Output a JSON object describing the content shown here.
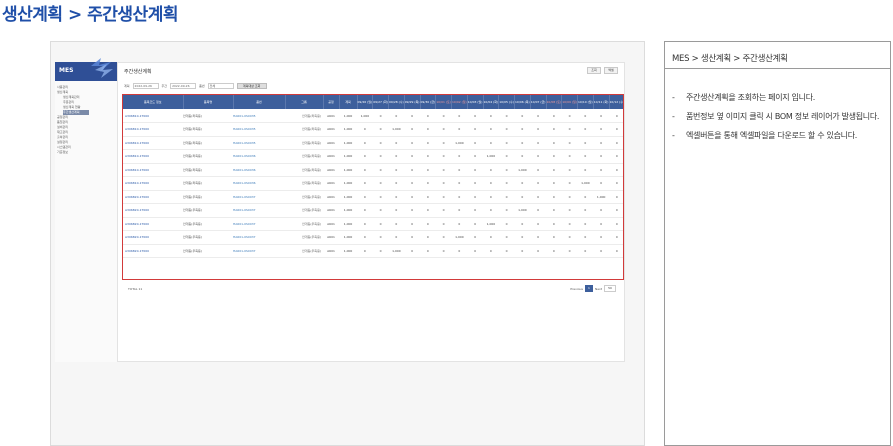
{
  "page_heading": "생산계획 > 주간생산계획",
  "screenshot": {
    "logo": "MES",
    "menu": [
      "사용관리",
      "생산계획",
      "생산계획관리",
      "주문관리",
      "생산계획 현황",
      "주간생산계획",
      "공정관리",
      "품질관리",
      "설비관리",
      "재고관리",
      "출하관리",
      "설정관리",
      "시스템관리",
      "기준정보"
    ],
    "title": "주간생산계획",
    "buttons": [
      "조회",
      "엑셀"
    ],
    "filters": {
      "label_plan": "계획",
      "plan_value": "2022-09-26",
      "label_week": "주간",
      "week_value": "2022-09-26",
      "label_item": "품번",
      "item_value": "전체",
      "search_label": "계획대상 조회"
    },
    "columns": [
      "품목코드 정보",
      "품목명",
      "품번",
      "그룹",
      "공정",
      "계획",
      "09/26 (월)",
      "09/27 (화)",
      "09/28 (수)",
      "09/29 (목)",
      "09/30 (금)",
      "10/01 (토)",
      "10/02 (일)",
      "10/03 (월)",
      "10/04 (화)",
      "10/05 (수)",
      "10/06 (목)",
      "10/07 (금)",
      "10/08 (토)",
      "10/09 (일)",
      "10/10 (월)",
      "10/11 (화)",
      "10/12 (수)"
    ],
    "rows": [
      {
        "code": "A306810-1T000",
        "name": "안개등(좌측용)",
        "part": "HA601-0S0035",
        "group": "안개등(좌측용)",
        "process": "A601",
        "plan": "1,000",
        "cells": [
          "1,000",
          "0",
          "0",
          "0",
          "0",
          "0",
          "0",
          "0",
          "0",
          "0",
          "0",
          "0",
          "0",
          "0",
          "0",
          "0",
          "0"
        ]
      },
      {
        "code": "A306810-1T000",
        "name": "안개등(좌측용)",
        "part": "HA601-0S0035",
        "group": "안개등(좌측용)",
        "process": "A601",
        "plan": "1,000",
        "cells": [
          "0",
          "0",
          "1,000",
          "0",
          "0",
          "0",
          "0",
          "0",
          "0",
          "0",
          "0",
          "0",
          "0",
          "0",
          "0",
          "0",
          "0"
        ]
      },
      {
        "code": "A306810-1T000",
        "name": "안개등(좌측용)",
        "part": "HA601-0S0035",
        "group": "안개등(좌측용)",
        "process": "A601",
        "plan": "1,000",
        "cells": [
          "0",
          "0",
          "0",
          "0",
          "0",
          "0",
          "1,000",
          "0",
          "0",
          "0",
          "0",
          "0",
          "0",
          "0",
          "0",
          "0",
          "0"
        ]
      },
      {
        "code": "A306810-1T000",
        "name": "안개등(좌측용)",
        "part": "HA601-0S0036",
        "group": "안개등(좌측용)",
        "process": "A601",
        "plan": "1,000",
        "cells": [
          "0",
          "0",
          "0",
          "0",
          "0",
          "0",
          "0",
          "0",
          "1,000",
          "0",
          "0",
          "0",
          "0",
          "0",
          "0",
          "0",
          "0"
        ]
      },
      {
        "code": "A306810-1T000",
        "name": "안개등(좌측용)",
        "part": "HA601-0S0036",
        "group": "안개등(좌측용)",
        "process": "A601",
        "plan": "1,000",
        "cells": [
          "0",
          "0",
          "0",
          "0",
          "0",
          "0",
          "0",
          "0",
          "0",
          "0",
          "1,000",
          "0",
          "0",
          "0",
          "0",
          "0",
          "0"
        ]
      },
      {
        "code": "A306810-1T000",
        "name": "안개등(좌측용)",
        "part": "HA601-0S0036",
        "group": "안개등(좌측용)",
        "process": "A601",
        "plan": "1,000",
        "cells": [
          "0",
          "0",
          "0",
          "0",
          "0",
          "0",
          "0",
          "0",
          "0",
          "0",
          "0",
          "0",
          "0",
          "0",
          "1,000",
          "0",
          "0"
        ]
      },
      {
        "code": "A306820-1T000",
        "name": "안개등(우측용)",
        "part": "HA601-0S0037",
        "group": "안개등(우측용)",
        "process": "A601",
        "plan": "1,000",
        "cells": [
          "0",
          "0",
          "0",
          "0",
          "0",
          "0",
          "0",
          "0",
          "0",
          "0",
          "0",
          "0",
          "0",
          "0",
          "0",
          "1,000",
          "0"
        ]
      },
      {
        "code": "A306820-1T000",
        "name": "안개등(우측용)",
        "part": "HA601-0S0037",
        "group": "안개등(우측용)",
        "process": "A601",
        "plan": "1,000",
        "cells": [
          "0",
          "0",
          "0",
          "0",
          "0",
          "0",
          "0",
          "0",
          "0",
          "0",
          "1,000",
          "0",
          "0",
          "0",
          "0",
          "0",
          "0"
        ]
      },
      {
        "code": "A306820-1T000",
        "name": "안개등(우측용)",
        "part": "HA601-0S0037",
        "group": "안개등(우측용)",
        "process": "A601",
        "plan": "1,000",
        "cells": [
          "0",
          "0",
          "0",
          "0",
          "0",
          "0",
          "0",
          "0",
          "1,000",
          "0",
          "0",
          "0",
          "0",
          "0",
          "0",
          "0",
          "0"
        ]
      },
      {
        "code": "A306820-1T000",
        "name": "안개등(우측용)",
        "part": "HA601-0S0037",
        "group": "안개등(우측용)",
        "process": "A601",
        "plan": "1,000",
        "cells": [
          "0",
          "0",
          "0",
          "0",
          "0",
          "0",
          "1,000",
          "0",
          "0",
          "0",
          "0",
          "0",
          "0",
          "0",
          "0",
          "0",
          "0"
        ]
      },
      {
        "code": "A306820-1T000",
        "name": "안개등(우측용)",
        "part": "HA601-0S0037",
        "group": "안개등(우측용)",
        "process": "A601",
        "plan": "1,000",
        "cells": [
          "0",
          "0",
          "1,000",
          "0",
          "0",
          "0",
          "0",
          "0",
          "0",
          "0",
          "0",
          "0",
          "0",
          "0",
          "0",
          "0",
          "0"
        ]
      }
    ],
    "footer_total": "TOTAL 11",
    "pager": {
      "previous": "Previous",
      "page": "1",
      "next": "Next",
      "size": "50"
    }
  },
  "description": {
    "path": "MES > 생산계획 > 주간생산계획",
    "items": [
      "주간생산계획을 조회하는 페이지 입니다.",
      "품번정보 옆 이미지 클릭 시 BOM 정보 레이어가 발생됩니다.",
      "엑셀버튼을 통해 엑셀파일을 다운로드 할 수 있습니다."
    ]
  },
  "colors": {
    "accent": "#1f4fa8",
    "header": "#3d5f9c",
    "highlight": "#d23a3a"
  }
}
